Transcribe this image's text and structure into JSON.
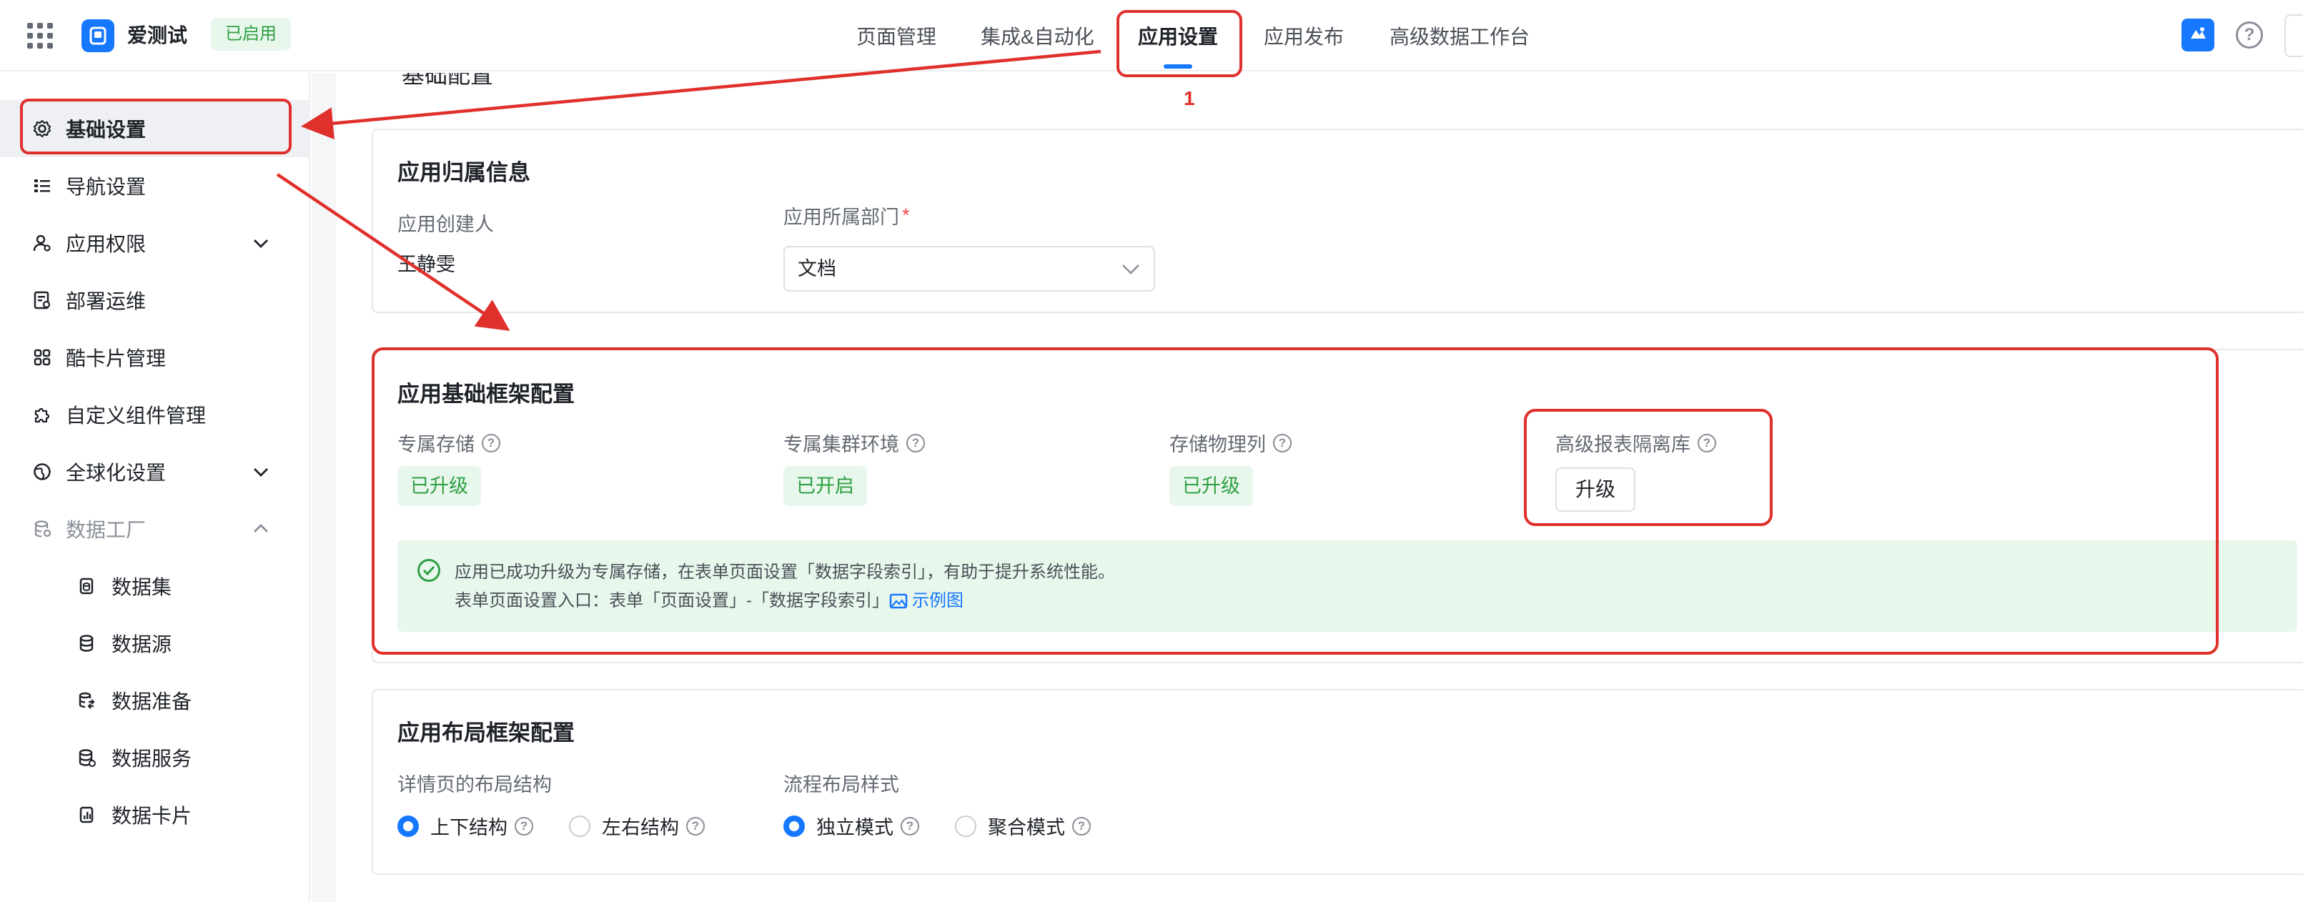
{
  "topbar": {
    "app_name": "爱测试",
    "app_status": "已启用",
    "tabs": [
      {
        "label": "页面管理"
      },
      {
        "label": "集成&自动化"
      },
      {
        "label": "应用设置"
      },
      {
        "label": "应用发布"
      },
      {
        "label": "高级数据工作台"
      }
    ],
    "active_tab": "应用设置"
  },
  "sidebar": {
    "items": [
      {
        "label": "基础设置",
        "icon": "gear-icon"
      },
      {
        "label": "导航设置",
        "icon": "list-icon"
      },
      {
        "label": "应用权限",
        "icon": "user-lock-icon"
      },
      {
        "label": "部署运维",
        "icon": "deploy-icon"
      },
      {
        "label": "酷卡片管理",
        "icon": "grid-icon"
      },
      {
        "label": "自定义组件管理",
        "icon": "puzzle-icon"
      },
      {
        "label": "全球化设置",
        "icon": "globe-icon"
      },
      {
        "label": "数据工厂",
        "icon": "database-icon"
      },
      {
        "label": "数据集",
        "icon": "dataset-icon"
      },
      {
        "label": "数据源",
        "icon": "datasource-icon"
      },
      {
        "label": "数据准备",
        "icon": "data-prep-icon"
      },
      {
        "label": "数据服务",
        "icon": "data-service-icon"
      },
      {
        "label": "数据卡片",
        "icon": "data-card-icon"
      }
    ]
  },
  "main": {
    "cut_title": "基础配置",
    "ownership": {
      "title": "应用归属信息",
      "creator_label": "应用创建人",
      "creator_value": "王静雯",
      "dept_label": "应用所属部门",
      "dept_required_mark": "*",
      "dept_value": "文档"
    },
    "framework": {
      "title": "应用基础框架配置",
      "items": [
        {
          "label": "专属存储",
          "status": "已升级"
        },
        {
          "label": "专属集群环境",
          "status": "已开启"
        },
        {
          "label": "存储物理列",
          "status": "已升级"
        },
        {
          "label": "高级报表隔离库",
          "button": "升级"
        }
      ],
      "notice_line1": "应用已成功升级为专属存储，在表单页面设置「数据字段索引」，有助于提升系统性能。",
      "notice_line2": "表单页面设置入口：表单「页面设置」-「数据字段索引」",
      "notice_link": "示例图"
    },
    "layout": {
      "title": "应用布局框架配置",
      "detail_label": "详情页的布局结构",
      "detail_options": [
        "上下结构",
        "左右结构"
      ],
      "detail_selected": "上下结构",
      "flow_label": "流程布局样式",
      "flow_options": [
        "独立模式",
        "聚合模式"
      ],
      "flow_selected": "独立模式"
    }
  },
  "annotation": {
    "number": "1"
  },
  "colors": {
    "accent": "#1677ff",
    "success": "#2ea043",
    "annotation": "#e0302b"
  }
}
